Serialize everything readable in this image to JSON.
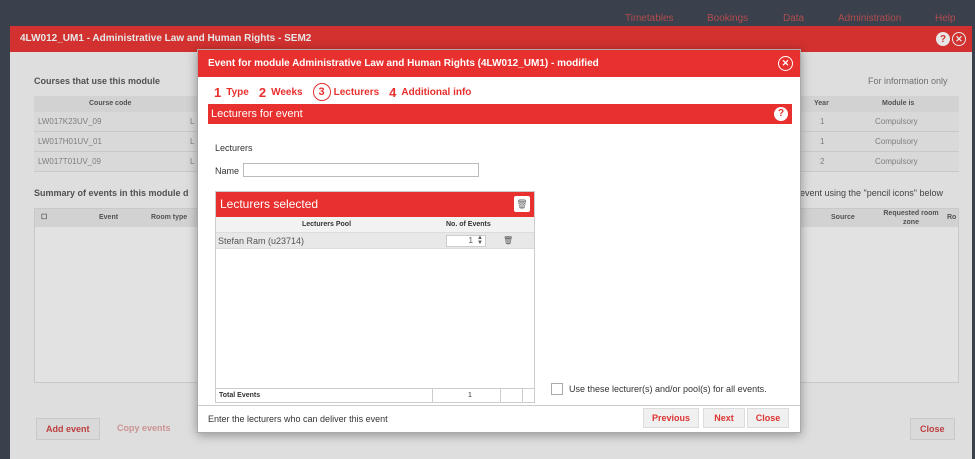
{
  "topnav": [
    "Timetables",
    "Bookings",
    "Data",
    "Administration",
    "Help"
  ],
  "window": {
    "title": "4LW012_UM1 - Administrative Law and Human Rights - SEM2"
  },
  "background": {
    "courses_heading": "Courses that use this module",
    "for_info": "For information only",
    "course_headers": {
      "code": "Course code",
      "year": "Year",
      "module_is": "Module is"
    },
    "course_rows": [
      {
        "code": "LW017K23UV_09",
        "mid": "L",
        "year": "1",
        "module_is": "Compulsory"
      },
      {
        "code": "LW017H01UV_01",
        "mid": "L",
        "year": "1",
        "module_is": "Compulsory"
      },
      {
        "code": "LW017T01UV_09",
        "mid": "L",
        "year": "2",
        "module_is": "Compulsory"
      }
    ],
    "summary_heading": "Summary of events in this module d",
    "summary_right": "event using the \"pencil icons\" below",
    "events_headers": {
      "event": "Event",
      "room_type": "Room type",
      "source": "Source",
      "requested_room_zone": "Requested room zone",
      "ro": "Ro"
    },
    "add_event": "Add event",
    "copy_events": "Copy events",
    "close": "Close"
  },
  "modal": {
    "title": "Event for module Administrative Law and Human Rights (4LW012_UM1) - modified",
    "steps": [
      {
        "num": "1",
        "label": "Type"
      },
      {
        "num": "2",
        "label": "Weeks"
      },
      {
        "num": "3",
        "label": "Lecturers"
      },
      {
        "num": "4",
        "label": "Additional info"
      }
    ],
    "section_title": "Lecturers for event",
    "lecturers_label": "Lecturers",
    "name_label": "Name",
    "name_value": "",
    "panel_title": "Lecturers selected",
    "col_pool": "Lecturers Pool",
    "col_events": "No. of Events",
    "rows": [
      {
        "name": "Stefan Ram (u23714)",
        "events": "1"
      }
    ],
    "total_label": "Total Events",
    "total_value": "1",
    "use_all_label": "Use these lecturer(s) and/or pool(s) for all events.",
    "footer_note": "Enter the lecturers who can deliver this event",
    "btn_previous": "Previous",
    "btn_next": "Next",
    "btn_close": "Close"
  }
}
